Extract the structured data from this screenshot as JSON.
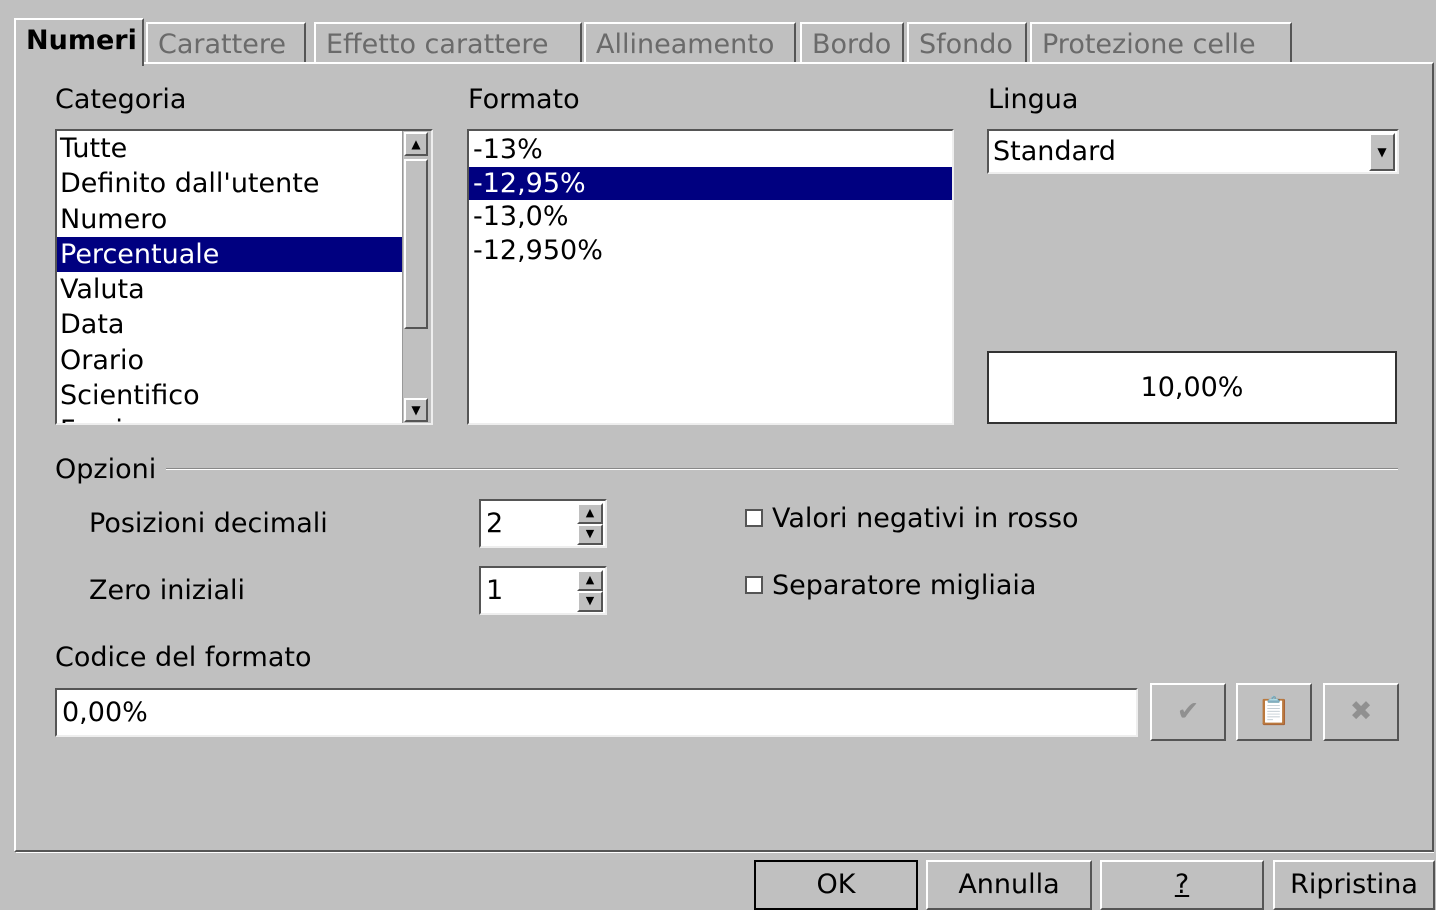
{
  "tabs": [
    {
      "label": "Numeri",
      "active": true
    },
    {
      "label": "Carattere",
      "active": false
    },
    {
      "label": "Effetto carattere",
      "active": false
    },
    {
      "label": "Allineamento",
      "active": false
    },
    {
      "label": "Bordo",
      "active": false
    },
    {
      "label": "Sfondo",
      "active": false
    },
    {
      "label": "Protezione celle",
      "active": false
    }
  ],
  "category": {
    "label": "Categoria",
    "items": [
      "Tutte",
      "Definito dall'utente",
      "Numero",
      "Percentuale",
      "Valuta",
      "Data",
      "Orario",
      "Scientifico",
      "Frazione"
    ],
    "selected": "Percentuale"
  },
  "format": {
    "label": "Formato",
    "items": [
      "-13%",
      "-12,95%",
      "-13,0%",
      "-12,950%"
    ],
    "selected": "-12,95%"
  },
  "language": {
    "label": "Lingua",
    "value": "Standard"
  },
  "preview": "10,00%",
  "options": {
    "label": "Opzioni",
    "decimal_label": "Posizioni decimali",
    "decimal_value": "2",
    "leading_label": "Zero iniziali",
    "leading_value": "1",
    "negative_red_label": "Valori negativi in rosso",
    "negative_red_checked": false,
    "thousands_label": "Separatore migliaia",
    "thousands_checked": false
  },
  "format_code": {
    "label": "Codice del formato",
    "value": "0,00%"
  },
  "buttons": {
    "ok": "OK",
    "cancel": "Annulla",
    "help": "?",
    "reset": "Ripristina"
  },
  "icons": {
    "accept": "checkmark-icon",
    "comment": "comment-icon",
    "delete": "delete-icon"
  }
}
